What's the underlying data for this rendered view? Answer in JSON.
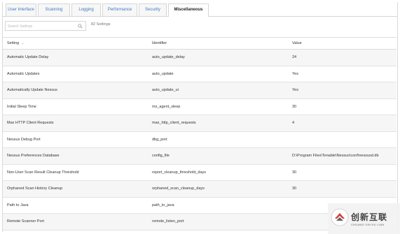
{
  "tabs": [
    {
      "label": "User Interface"
    },
    {
      "label": "Scanning"
    },
    {
      "label": "Logging"
    },
    {
      "label": "Performance"
    },
    {
      "label": "Security"
    },
    {
      "label": "Miscellaneous",
      "active": true
    }
  ],
  "search": {
    "placeholder": "Search Settings",
    "icon": "search-icon"
  },
  "count_text": "82 Settings",
  "table": {
    "headers": {
      "setting": "Setting",
      "identifier": "Identifier",
      "value": "Value"
    },
    "rows": [
      {
        "setting": "Automatic Update Delay",
        "identifier": "auto_update_delay",
        "value": "24"
      },
      {
        "setting": "Automatic Updates",
        "identifier": "auto_update",
        "value": "Yes"
      },
      {
        "setting": "Automatically Update Nessus",
        "identifier": "auto_update_ui",
        "value": "Yes"
      },
      {
        "setting": "Initial Sleep Time",
        "identifier": "ms_agent_sleep",
        "value": "30"
      },
      {
        "setting": "Max HTTP Client Requests",
        "identifier": "max_http_client_requests",
        "value": "4"
      },
      {
        "setting": "Nessus Debug Port",
        "identifier": "dbg_port",
        "value": ""
      },
      {
        "setting": "Nessus Preferences Database",
        "identifier": "config_file",
        "value": "D:\\Program Files\\Tenable\\Nessus\\conf\\nessusd.db"
      },
      {
        "setting": "Non-User Scan Result Cleanup Threshold",
        "identifier": "report_cleanup_threshold_days",
        "value": "30"
      },
      {
        "setting": "Orphaned Scan History Cleanup",
        "identifier": "orphaned_scan_cleanup_days",
        "value": "30"
      },
      {
        "setting": "Path to Java",
        "identifier": "path_to_java",
        "value": ""
      },
      {
        "setting": "Remote Scanner Port",
        "identifier": "remote_listen_port",
        "value": ""
      }
    ]
  },
  "watermark": {
    "text": "创新互联",
    "sub": "CHUANG XIN HU LIAN"
  },
  "colors": {
    "tab_link": "#3c78c3",
    "row_alt": "#f6f6f6",
    "border": "#d6d6d6"
  }
}
